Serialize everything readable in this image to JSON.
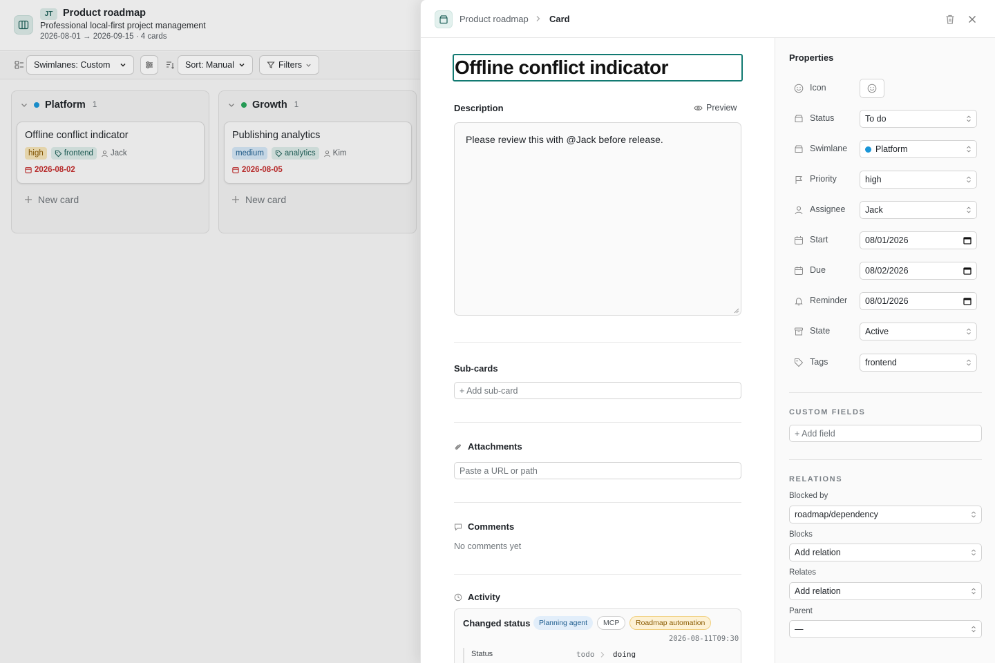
{
  "board": {
    "initials": "JT",
    "project_title": "Product roadmap",
    "project_subtitle": "Professional local-first project management",
    "project_meta": "2026-08-01 → 2026-09-15 · 4 cards",
    "toolbar": {
      "swimlanes": "Swimlanes: Custom",
      "sort": "Sort: Manual",
      "filters": "Filters"
    },
    "columns": [
      {
        "name": "Platform",
        "count": "1",
        "color": "#1a96d8",
        "card": {
          "title": "Offline conflict indicator",
          "priority": "high",
          "tag": "frontend",
          "assignee": "Jack",
          "date": "2026-08-02"
        },
        "new_card": "New card"
      },
      {
        "name": "Growth",
        "count": "1",
        "color": "#25a55a",
        "card": {
          "title": "Publishing analytics",
          "priority": "medium",
          "tag": "analytics",
          "assignee": "Kim",
          "date": "2026-08-05"
        },
        "new_card": "New card"
      }
    ]
  },
  "drawer": {
    "breadcrumb": {
      "project": "Product roadmap",
      "current": "Card"
    },
    "title": "Offline conflict indicator",
    "description": {
      "label": "Description",
      "preview_label": "Preview",
      "text": "Please review this with @Jack before release."
    },
    "subcards": {
      "label": "Sub-cards",
      "placeholder": "+ Add sub-card"
    },
    "attachments": {
      "label": "Attachments",
      "placeholder": "Paste a URL or path"
    },
    "comments": {
      "label": "Comments",
      "empty": "No comments yet"
    },
    "activity": {
      "label": "Activity",
      "entry": {
        "title": "Changed status",
        "badges": [
          "Planning agent",
          "MCP",
          "Roadmap automation"
        ],
        "timestamp": "2026-08-11T09:30",
        "field": "Status",
        "from": "todo",
        "to": "doing"
      }
    },
    "properties": {
      "title": "Properties",
      "icon_label": "Icon",
      "status_label": "Status",
      "status": "To do",
      "swimlane_label": "Swimlane",
      "swimlane": "Platform",
      "priority_label": "Priority",
      "priority": "high",
      "assignee_label": "Assignee",
      "assignee": "Jack",
      "start_label": "Start",
      "start": "08/01/2026",
      "due_label": "Due",
      "due": "08/02/2026",
      "reminder_label": "Reminder",
      "reminder": "08/01/2026",
      "state_label": "State",
      "state": "Active",
      "tags_label": "Tags",
      "tags": "frontend"
    },
    "custom_fields": {
      "label": "CUSTOM FIELDS",
      "add": "+ Add field"
    },
    "relations": {
      "label": "RELATIONS",
      "blocked_by_label": "Blocked by",
      "blocked_by": "roadmap/dependency",
      "blocks_label": "Blocks",
      "blocks": "Add relation",
      "relates_label": "Relates",
      "relates": "Add relation",
      "parent_label": "Parent",
      "parent": "—"
    }
  },
  "colors": {
    "accent": "#127a72",
    "platform": "#1a96d8",
    "growth": "#25a55a",
    "overdue": "#c42b2b"
  }
}
